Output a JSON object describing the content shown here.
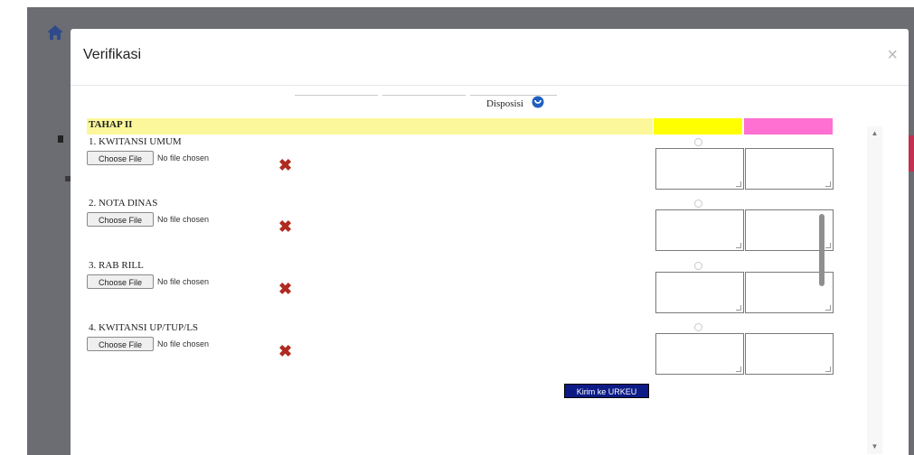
{
  "modal": {
    "title": "Verifikasi",
    "close_symbol": "×"
  },
  "header": {
    "disposisi_label": "Disposisi",
    "section_title": "TAHAP II"
  },
  "items": [
    {
      "label": "1. KWITANSI UMUM",
      "button": "Choose File",
      "file_status": "No file chosen"
    },
    {
      "label": "2. NOTA DINAS",
      "button": "Choose File",
      "file_status": "No file chosen"
    },
    {
      "label": "3. RAB RILL",
      "button": "Choose File",
      "file_status": "No file chosen"
    },
    {
      "label": "4. KWITANSI UP/TUP/LS",
      "button": "Choose File",
      "file_status": "No file chosen"
    }
  ],
  "status_mark": "✖",
  "submit_label": "Kirim ke URKEU",
  "colors": {
    "tahap_bar": "#fbf79a",
    "yellow_cell": "#ffff00",
    "pink_cell": "#ff70d2",
    "submit_bg": "#0c1b86",
    "x_mark": "#b02a20"
  },
  "icons": {
    "home": "home-icon",
    "close": "close-icon",
    "disposisi": "info-circle-icon",
    "missing": "cross-icon"
  },
  "scrollbar": {
    "up_arrow": "▲",
    "down_arrow": "▼"
  }
}
